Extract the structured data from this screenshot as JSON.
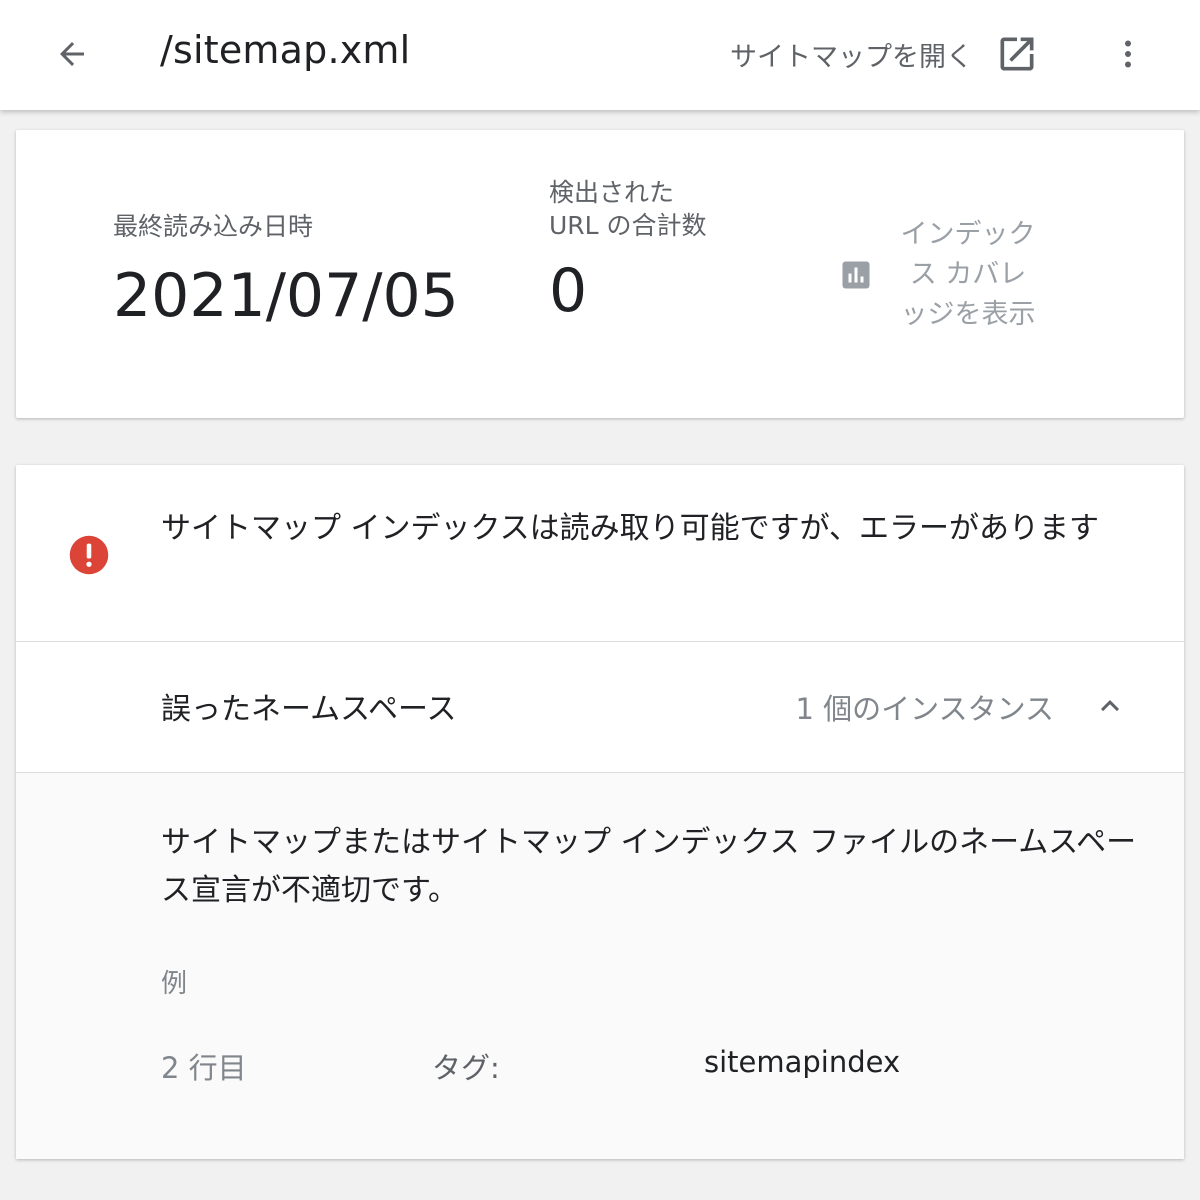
{
  "header": {
    "title": "/sitemap.xml",
    "open_sitemap_label": "サイトマップを開く"
  },
  "summary": {
    "last_read_label": "最終読み込み日時",
    "last_read_value": "2021/07/05",
    "discovered_label": "検出された URL の合計数",
    "discovered_value": "0",
    "coverage_label": "インデックス カバレッジを表示"
  },
  "error": {
    "title": "サイトマップ インデックスは読み取り可能ですが、エラーがあります",
    "issue_name": "誤ったネームスペース",
    "issue_count": "1 個のインスタンス",
    "description": "サイトマップまたはサイトマップ インデックス ファイルのネームスペース宣言が不適切です。",
    "example_label": "例",
    "example": {
      "line": "2 行目",
      "tag_label": "タグ:",
      "tag_value": "sitemapindex"
    }
  },
  "colors": {
    "error_red": "#db4437",
    "text_primary": "#202124",
    "text_secondary": "#5f6368",
    "icon_grey": "#9aa0a6"
  }
}
